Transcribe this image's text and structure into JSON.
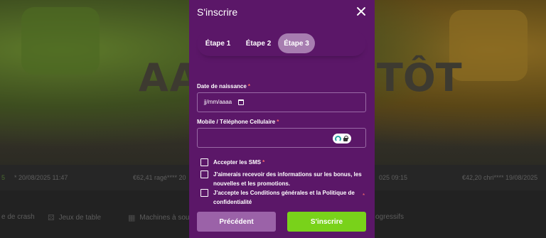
{
  "background": {
    "banner_text": "AAA",
    "banner_text_right": "TÔT",
    "ticker": [
      {
        "text": "5"
      },
      {
        "text": "* 20/08/2025 11:47"
      },
      {
        "text": "€62,41 ragé**** 20"
      },
      {
        "text": "025 09:15"
      },
      {
        "text": "€42,20 chri**** 19/08/2025"
      }
    ],
    "nav": [
      {
        "label": "e de crash"
      },
      {
        "label": "Jeux de table"
      },
      {
        "label": "Machines à sou"
      },
      {
        "label": "ogressifs"
      }
    ]
  },
  "modal": {
    "title": "S'inscrire",
    "steps": [
      {
        "label": "Étape 1"
      },
      {
        "label": "Étape 2"
      },
      {
        "label": "Étape 3"
      }
    ],
    "active_step": 3,
    "date_field": {
      "label": "Date de naissance",
      "required_mark": "*",
      "placeholder": "jj/mm/aaaa"
    },
    "phone_field": {
      "label": "Mobile / Téléphone Cellulaire",
      "required_mark": "*",
      "value": ""
    },
    "checkboxes": [
      {
        "label": "Accepter les SMS",
        "required_mark": "*"
      },
      {
        "label": "J'aimerais recevoir des informations sur les bonus, les nouvelles et les promotions.",
        "required_mark": ""
      },
      {
        "label": "J'accepte les Conditions générales et la Politique de confidentialité",
        "required_mark": "*"
      }
    ],
    "buttons": {
      "previous": "Précédent",
      "submit": "S'inscrire"
    }
  },
  "colors": {
    "modal_bg": "#5b1768",
    "active_step_bg": "#a77db0",
    "previous_button": "#9b62a8",
    "submit_button": "#79d21a",
    "required_mark": "#ff6b6b"
  },
  "icons": [
    "close-icon",
    "calendar-icon",
    "password-manager-icon"
  ]
}
